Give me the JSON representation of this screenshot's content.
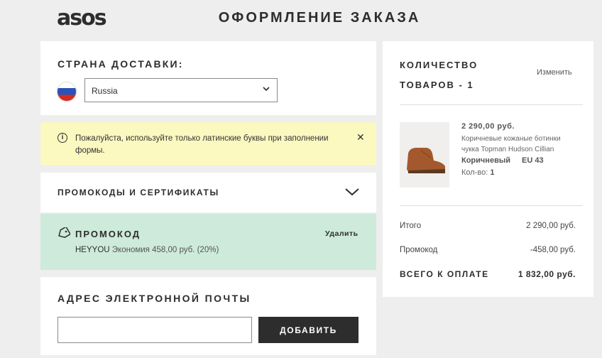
{
  "header": {
    "logo": "asos",
    "title": "ОФОРМЛЕНИЕ ЗАКАЗА"
  },
  "country": {
    "heading": "СТРАНА ДОСТАВКИ:",
    "selected": "Russia"
  },
  "notice": {
    "text": "Пожалуйста, используйте только латинские буквы при заполнении формы.",
    "close": "✕"
  },
  "promo_section": {
    "heading": "ПРОМОКОДЫ И СЕРТИФИКАТЫ"
  },
  "promo_applied": {
    "heading": "ПРОМОКОД",
    "remove": "Удалить",
    "code": "HEYYOU",
    "saving": "Экономия 458,00 руб. (20%)"
  },
  "email": {
    "heading": "АДРЕС ЭЛЕКТРОННОЙ ПОЧТЫ",
    "value": "",
    "button": "ДОБАВИТЬ"
  },
  "summary": {
    "title": "КОЛИЧЕСТВО ТОВАРОВ - 1",
    "edit": "Изменить",
    "item": {
      "price": "2 290,00 руб.",
      "name": "Коричневые кожаные ботинки чукка Topman Hudson Cillian",
      "color": "Коричневый",
      "size": "EU 43",
      "qty_label": "Кол-во:",
      "qty": "1"
    },
    "rows": [
      {
        "label": "Итого",
        "value": "2 290,00 руб."
      },
      {
        "label": "Промокод",
        "value": "-458,00 руб."
      }
    ],
    "total": {
      "label": "ВСЕГО К ОПЛАТЕ",
      "value": "1 832,00 руб."
    }
  }
}
